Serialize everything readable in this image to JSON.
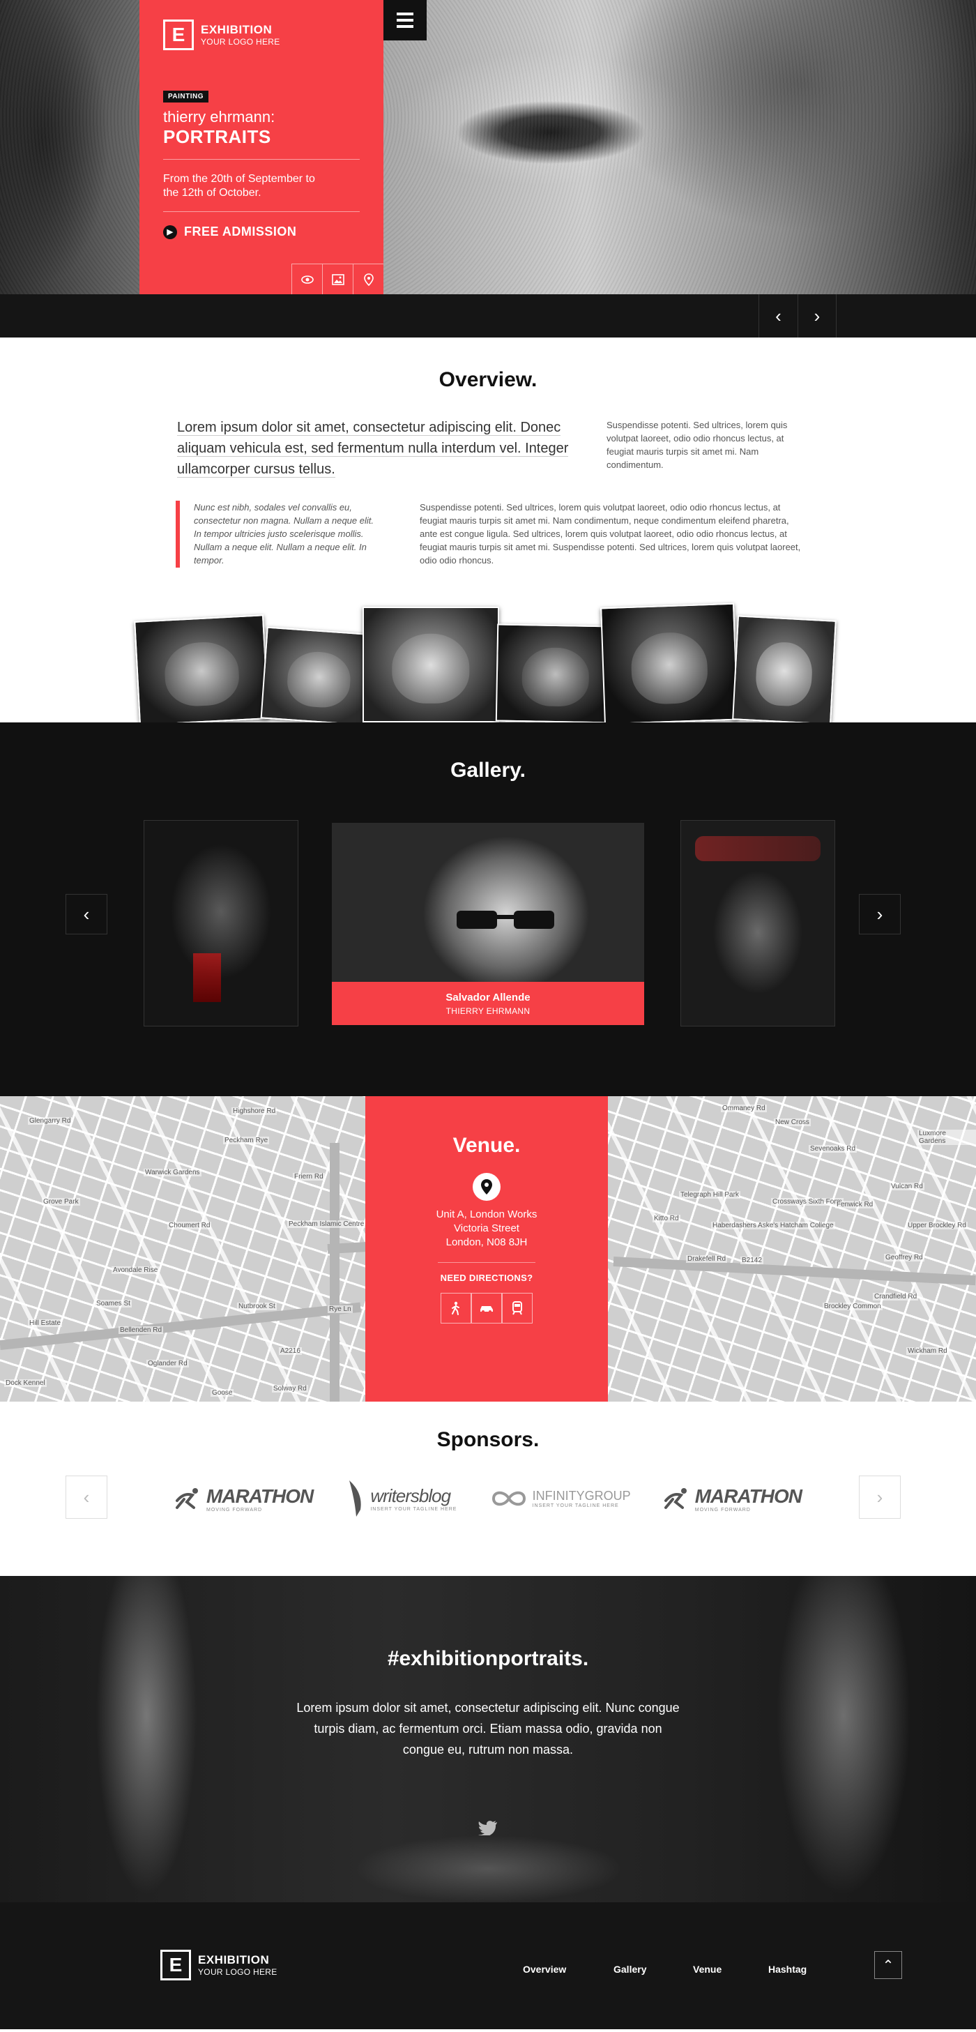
{
  "colors": {
    "accent": "#f64046",
    "dark": "#111111",
    "page_bg": "#ffffff"
  },
  "brand": {
    "mark": "E",
    "name": "EXHIBITION",
    "tagline": "YOUR LOGO HERE"
  },
  "hero": {
    "category": "PAINTING",
    "artist": "thierry ehrmann:",
    "title": "PORTRAITS",
    "dates": "From the 20th of September to the 12th of October.",
    "admission": "FREE ADMISSION",
    "icons": [
      "eye-icon",
      "image-icon",
      "location-icon"
    ],
    "nav_prev": "‹",
    "nav_next": "›"
  },
  "overview": {
    "title": "Overview.",
    "lead": "Lorem ipsum dolor sit amet, consectetur adipiscing elit. Donec aliquam vehicula est, sed fermentum nulla interdum vel. Integer ullamcorper cursus tellus.",
    "side": "Suspendisse potenti. Sed ultrices, lorem quis volutpat laoreet, odio odio rhoncus lectus, at feugiat mauris turpis sit amet mi. Nam condimentum.",
    "quote": "Nunc est nibh, sodales vel convallis eu, consectetur non magna. Nullam a neque elit. In tempor ultricies justo scelerisque mollis. Nullam a neque elit. Nullam a neque elit. In tempor.",
    "body": "Suspendisse potenti. Sed ultrices, lorem quis volutpat laoreet, odio odio rhoncus lectus, at feugiat mauris turpis sit amet mi. Nam condimentum, neque condimentum eleifend pharetra, ante est congue ligula. Sed ultrices, lorem quis volutpat laoreet, odio odio rhoncus lectus, at feugiat mauris turpis sit amet mi. Suspendisse potenti. Sed ultrices, lorem quis volutpat laoreet, odio odio rhoncus."
  },
  "gallery": {
    "title": "Gallery.",
    "featured_name": "Salvador Allende",
    "featured_artist": "THIERRY EHRMANN",
    "prev": "‹",
    "next": "›"
  },
  "venue": {
    "title": "Venue.",
    "address_line1": "Unit A, London Works",
    "address_line2": "Victoria Street",
    "address_line3": "London, N08 8JH",
    "directions": "NEED DIRECTIONS?",
    "modes": [
      "walk-icon",
      "car-icon",
      "train-icon"
    ],
    "map_labels": [
      "Highshore Rd",
      "Peckham Rye",
      "Warwick Gardens",
      "Choumert Rd",
      "Peckham Islamic Centre",
      "Rye Ln",
      "Grove Park",
      "Glengarry Rd",
      "Bellenden Rd",
      "Nutbrook St",
      "Avondale Rise",
      "Soames St",
      "Oglander Rd",
      "Solway Rd",
      "Goose",
      "Friern Rd",
      "Hill Estate",
      "Dock Kennel",
      "A2216",
      "Ommaney Rd",
      "New Cross",
      "Telegraph Hill Park",
      "Haberdashers Aske's Hatcham College",
      "Crossways Sixth Form",
      "Drakefell Rd",
      "B2142",
      "Brockley Common",
      "Crandfield Rd",
      "Wickham Rd",
      "Geoffrey Rd",
      "Vulcan Rd",
      "Luxmore Gardens",
      "Upper Brockley Rd",
      "Kitto Rd",
      "Sevenoaks Rd",
      "Fenwick Rd"
    ]
  },
  "sponsors": {
    "title": "Sponsors.",
    "prev": "‹",
    "next": "›",
    "logos": [
      {
        "name": "MARATHON",
        "tag": "MOVING FORWARD"
      },
      {
        "name": "writersblog",
        "tag": "INSERT YOUR TAGLINE HERE"
      },
      {
        "name": "INFINITYGROUP",
        "tag": "INSERT YOUR TAGLINE HERE"
      },
      {
        "name": "MARATHON",
        "tag": "MOVING FORWARD"
      }
    ]
  },
  "hashtag": {
    "title": "#exhibitionportraits.",
    "body": "Lorem ipsum dolor sit amet, consectetur adipiscing elit. Nunc congue turpis diam, ac fermentum orci. Etiam massa odio, gravida non congue eu, rutrum non massa."
  },
  "footer": {
    "nav": [
      "Overview",
      "Gallery",
      "Venue",
      "Hashtag"
    ],
    "top": "⌃"
  }
}
